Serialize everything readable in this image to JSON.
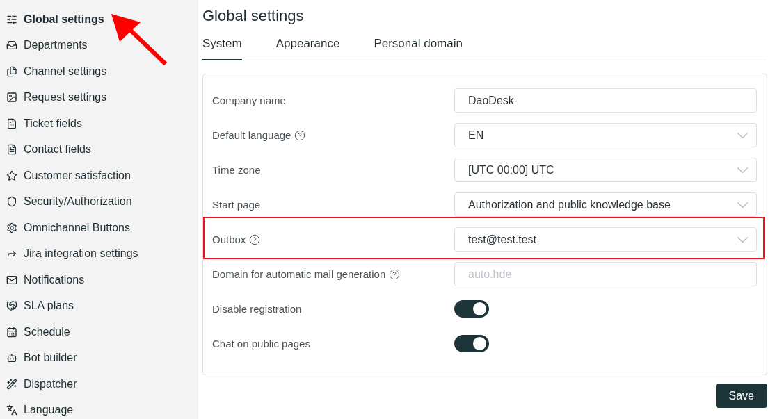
{
  "sidebar": {
    "items": [
      {
        "label": "Global settings",
        "selected": true,
        "annotated": true
      },
      {
        "label": "Departments",
        "selected": false,
        "annotated": false
      },
      {
        "label": "Channel settings",
        "selected": false,
        "annotated": false
      },
      {
        "label": "Request settings",
        "selected": false,
        "annotated": false
      },
      {
        "label": "Ticket fields",
        "selected": false,
        "annotated": false
      },
      {
        "label": "Contact fields",
        "selected": false,
        "annotated": false
      },
      {
        "label": "Customer satisfaction",
        "selected": false,
        "annotated": false
      },
      {
        "label": "Security/Authorization",
        "selected": false,
        "annotated": false
      },
      {
        "label": "Omnichannel Buttons",
        "selected": false,
        "annotated": false
      },
      {
        "label": "Jira integration settings",
        "selected": false,
        "annotated": false
      },
      {
        "label": "Notifications",
        "selected": false,
        "annotated": false
      },
      {
        "label": "SLA plans",
        "selected": false,
        "annotated": false
      },
      {
        "label": "Schedule",
        "selected": false,
        "annotated": false
      },
      {
        "label": "Bot builder",
        "selected": false,
        "annotated": false
      },
      {
        "label": "Dispatcher",
        "selected": false,
        "annotated": false
      },
      {
        "label": "Language",
        "selected": false,
        "annotated": false
      }
    ]
  },
  "page": {
    "title": "Global settings"
  },
  "tabs": [
    {
      "label": "System",
      "selected": true
    },
    {
      "label": "Appearance",
      "selected": false
    },
    {
      "label": "Personal domain",
      "selected": false
    }
  ],
  "form": {
    "rows": [
      {
        "kind": "input",
        "label": "Company name",
        "help": false,
        "highlighted": false,
        "value": "DaoDesk"
      },
      {
        "kind": "select",
        "label": "Default language",
        "help": true,
        "highlighted": false,
        "value": "EN"
      },
      {
        "kind": "select",
        "label": "Time zone",
        "help": false,
        "highlighted": false,
        "value": "[UTC 00:00] UTC"
      },
      {
        "kind": "select",
        "label": "Start page",
        "help": false,
        "highlighted": false,
        "value": "Authorization and public knowledge base"
      },
      {
        "kind": "select",
        "label": "Outbox",
        "help": true,
        "highlighted": true,
        "value": "test@test.test"
      },
      {
        "kind": "input",
        "label": "Domain for automatic mail generation",
        "help": true,
        "highlighted": false,
        "placeholder": "auto.hde"
      },
      {
        "kind": "toggle",
        "label": "Disable registration",
        "help": false,
        "highlighted": false,
        "on": true
      },
      {
        "kind": "toggle",
        "label": "Chat on public pages",
        "help": false,
        "highlighted": false,
        "on": true
      }
    ]
  },
  "buttons": [
    {
      "label": "Save"
    }
  ]
}
